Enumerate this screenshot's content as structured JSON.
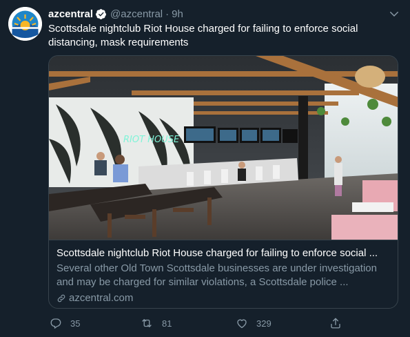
{
  "tweet": {
    "author_name": "azcentral",
    "handle": "@azcentral",
    "separator": "·",
    "time": "9h",
    "text": "Scottsdale nightclub Riot House charged for failing to enforce social distancing, mask requirements"
  },
  "card": {
    "title": "Scottsdale nightclub Riot House charged for failing to enforce social ...",
    "description": "Several other Old Town Scottsdale businesses are under investigation and may be charged for similar violations, a Scottsdale police ...",
    "domain": "azcentral.com",
    "image_sign": "RIOT HOUSE"
  },
  "actions": {
    "replies": "35",
    "retweets": "81",
    "likes": "329"
  },
  "icons": [
    "verified-badge-icon",
    "caret-down-icon",
    "link-icon",
    "reply-icon",
    "retweet-icon",
    "like-icon",
    "share-icon"
  ],
  "colors": {
    "background": "#15202b",
    "border": "#38444d",
    "secondary_text": "#8899a6",
    "brand_blue": "#1da1f2"
  }
}
